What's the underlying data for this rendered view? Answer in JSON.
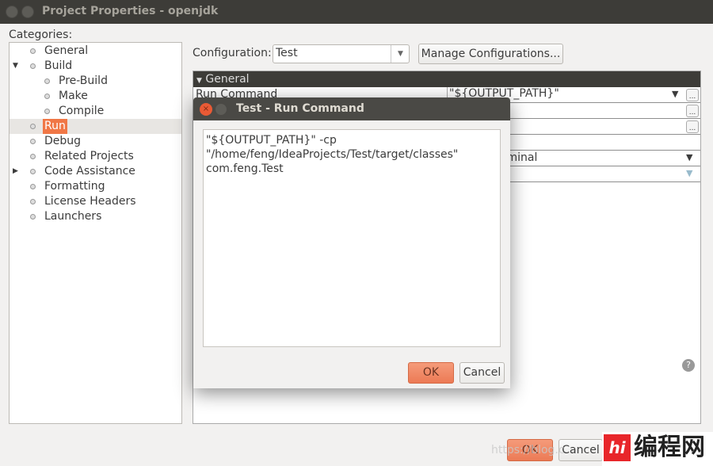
{
  "window": {
    "title": "Project Properties - openjdk"
  },
  "categories": {
    "label": "Categories:",
    "items": [
      {
        "label": "General",
        "level": 0
      },
      {
        "label": "Build",
        "level": 0,
        "expanded": true
      },
      {
        "label": "Pre-Build",
        "level": 1
      },
      {
        "label": "Make",
        "level": 1
      },
      {
        "label": "Compile",
        "level": 1
      },
      {
        "label": "Run",
        "level": 0,
        "selected": true
      },
      {
        "label": "Debug",
        "level": 0
      },
      {
        "label": "Related Projects",
        "level": 0
      },
      {
        "label": "Code Assistance",
        "level": 0,
        "collapsed": true
      },
      {
        "label": "Formatting",
        "level": 0
      },
      {
        "label": "License Headers",
        "level": 0
      },
      {
        "label": "Launchers",
        "level": 0
      }
    ]
  },
  "configuration": {
    "label": "Configuration:",
    "value": "Test",
    "manage_label": "Manage Configurations..."
  },
  "properties": {
    "section": "General",
    "run_command_label": "Run Command",
    "run_command_value": "\"${OUTPUT_PATH}\"",
    "console_value_partial": "rminal",
    "ellipsis": "..."
  },
  "dialog": {
    "title": "Test - Run Command",
    "text": "\"${OUTPUT_PATH}\" -cp\n\"/home/feng/IdeaProjects/Test/target/classes\"\ncom.feng.Test",
    "ok": "OK",
    "cancel": "Cancel"
  },
  "footer": {
    "ok": "OK",
    "cancel": "Cancel"
  },
  "watermark": {
    "url": "https://blog.c",
    "logo": "编程网"
  },
  "colors": {
    "accent": "#f07746",
    "titlebar": "#3d3c38"
  }
}
